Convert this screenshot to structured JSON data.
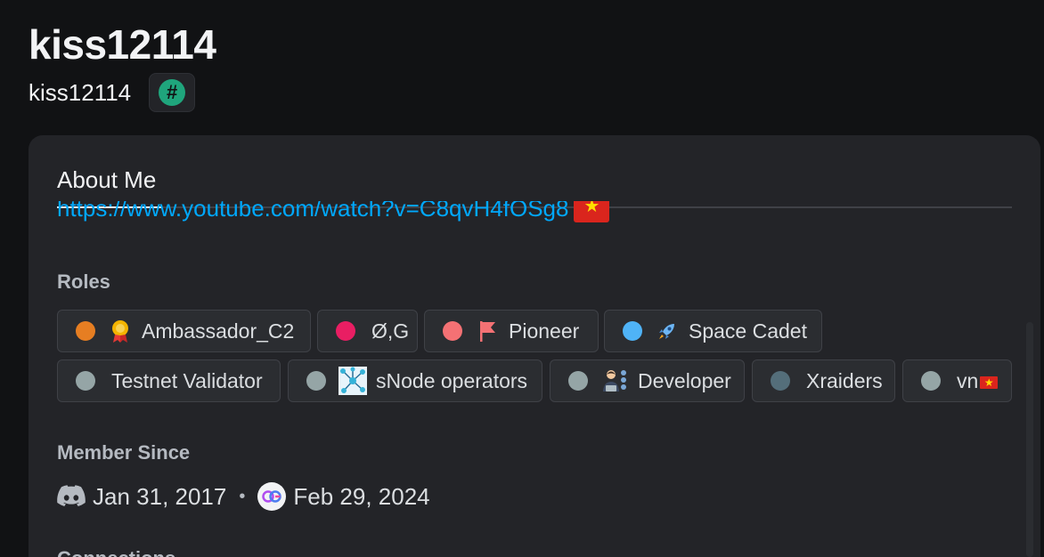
{
  "profile": {
    "display_name": "kiss12114",
    "username": "kiss12114",
    "tag_icon": "hash-icon",
    "tag_symbol": "#"
  },
  "tabs": {
    "about_label": "About Me"
  },
  "bio": {
    "link_text": "https://www.youtube.com/watch?v=C8qvH4fOSg8",
    "flag_icon": "vietnam-flag-icon"
  },
  "roles": {
    "title": "Roles",
    "items": [
      {
        "label": "Ambassador_C2",
        "color": "#e67e22",
        "icon": "medal-icon"
      },
      {
        "label": "Ø,G",
        "color": "#e91e63",
        "icon": ""
      },
      {
        "label": "Pioneer",
        "color": "#f47174",
        "icon": "flag-icon"
      },
      {
        "label": "Space Cadet",
        "color": "#4fb3f7",
        "icon": "rocket-icon"
      },
      {
        "label": "Testnet Validator",
        "color": "#95a5a6",
        "icon": ""
      },
      {
        "label": "sNode operators",
        "color": "#95a5a6",
        "icon": "network-icon"
      },
      {
        "label": "Developer",
        "color": "#95a5a6",
        "icon": "developer-icon"
      },
      {
        "label": "Xraiders",
        "color": "#546e7a",
        "icon": ""
      },
      {
        "label": "vn",
        "color": "#95a5a6",
        "icon": "vietnam-flag-icon"
      }
    ]
  },
  "member_since": {
    "title": "Member Since",
    "discord_date": "Jan 31, 2017",
    "discord_icon": "discord-icon",
    "separator": "•",
    "server_date": "Feb 29, 2024",
    "server_icon": "0g-server-icon"
  },
  "connections": {
    "title": "Connections"
  },
  "colors": {
    "background": "#111214",
    "card": "#232428",
    "link": "#00a8fc",
    "tag_badge": "#1fa57c"
  }
}
